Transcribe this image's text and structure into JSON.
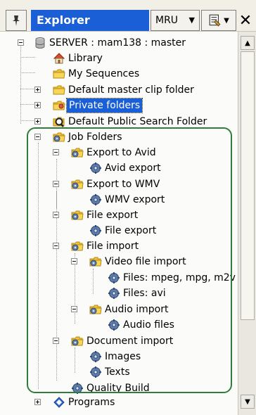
{
  "header": {
    "pin_glyph": "📌",
    "title": "Explorer",
    "mru_label": "MRU",
    "dropdown_glyph": "▼",
    "props_glyph": "🗔",
    "close_glyph": "✕"
  },
  "tree": {
    "root": "SERVER : mam138 : master",
    "library": "Library",
    "my_sequences": "My Sequences",
    "default_master_clip_folder": "Default master clip folder",
    "private_folders": "Private folders",
    "default_public_search_folder": "Default Public Search Folder",
    "job_folders": "Job Folders",
    "export_to_avid": "Export to Avid",
    "avid_export": "Avid export",
    "export_to_wmv": "Export to WMV",
    "wmv_export": "WMV export",
    "file_export_folder": "File export",
    "file_export_job": "File export",
    "file_import": "File import",
    "video_file_import": "Video file import",
    "files_mpeg": "Files: mpeg, mpg, m2v",
    "files_avi": "Files: avi",
    "audio_import": "Audio import",
    "audio_files": "Audio files",
    "document_import": "Document import",
    "images": "Images",
    "texts": "Texts",
    "quality_build": "Quality Build",
    "programs": "Programs"
  },
  "scroll": {
    "up_glyph": "▲",
    "down_glyph": "▼"
  },
  "colors": {
    "accent": "#1a5fd6",
    "highlight_frame": "#2f7d3a",
    "folder": "#f2c23a",
    "gear": "#3f5f8c"
  }
}
